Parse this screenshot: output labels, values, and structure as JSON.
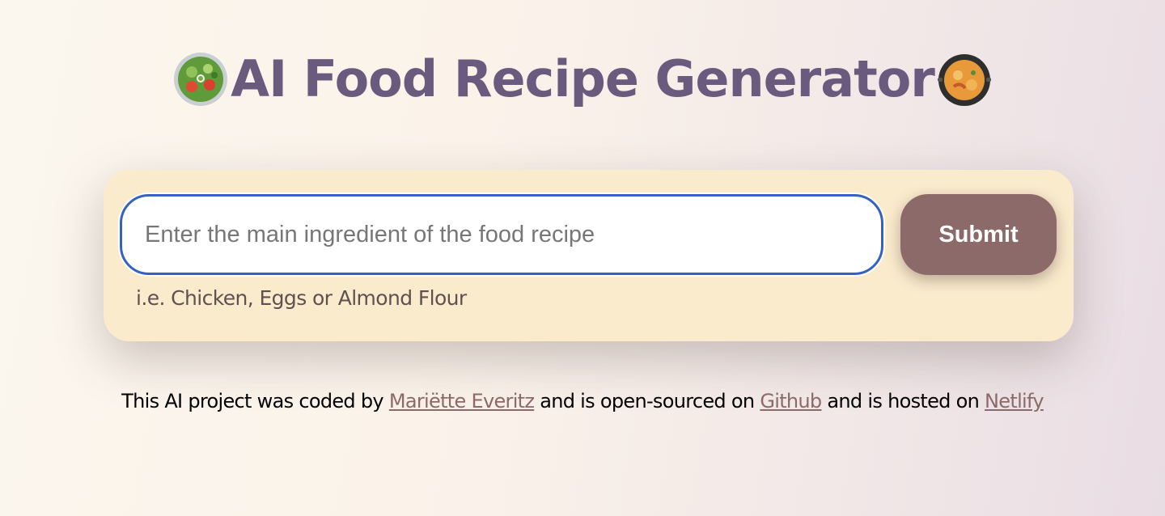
{
  "header": {
    "title": "AI Food Recipe Generator",
    "left_icon": "salad-bowl-icon",
    "right_icon": "paella-pan-icon"
  },
  "form": {
    "input_placeholder": "Enter the main ingredient of the food recipe",
    "input_value": "",
    "submit_label": "Submit",
    "hint": "i.e. Chicken, Eggs or Almond Flour"
  },
  "footer": {
    "text_1": "This AI project was coded by ",
    "author_link": "Mariëtte Everitz",
    "text_2": " and is open-sourced on ",
    "github_link": "Github",
    "text_3": " and is hosted on ",
    "netlify_link": "Netlify"
  },
  "colors": {
    "title": "#6a5a7d",
    "card_background": "#fbebcd",
    "button": "#8b6a69",
    "input_border": "#3562c0",
    "link": "#8b6a69"
  }
}
